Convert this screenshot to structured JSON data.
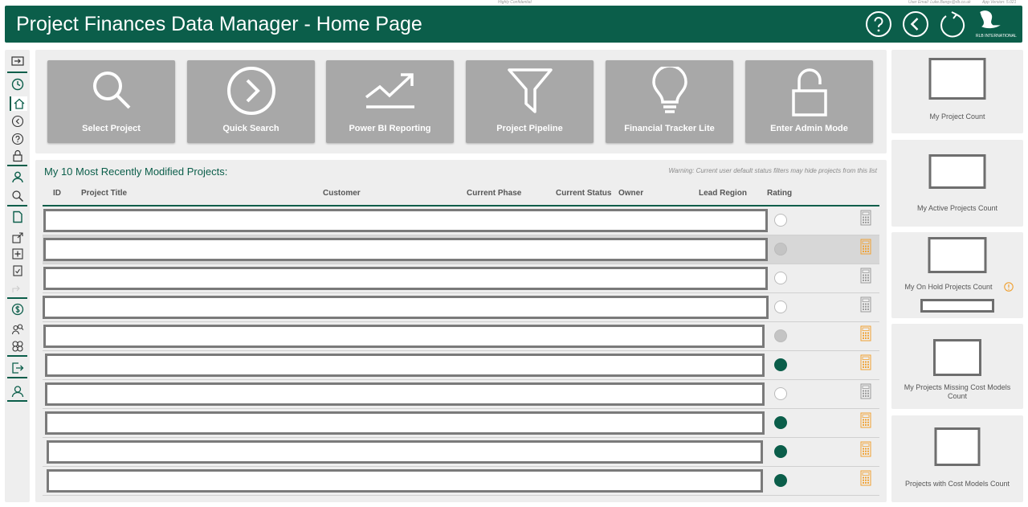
{
  "meta": {
    "confidential": "Highly Confidential",
    "user_email": "User Email: Luke.Bangs@rlb.co.uk",
    "app_version": "App Version: 5.021"
  },
  "header": {
    "title": "Project Finances Data Manager - Home Page",
    "logo_text": "RLB INTERNATIONAL",
    "help_icon": "question-circle-icon",
    "back_icon": "chevron-left-circle-icon",
    "refresh_icon": "refresh-icon"
  },
  "sidebar": {
    "items": [
      "collapse-toggle-icon",
      "clock-icon",
      "home-icon",
      "back-icon",
      "help-icon",
      "lock-icon",
      "user-icon",
      "search-icon",
      "document-icon",
      "open-external-icon",
      "add-icon",
      "checklist-icon",
      "share-icon",
      "dollar-icon",
      "users-search-icon",
      "people-group-icon",
      "exit-icon",
      "user-settings-icon"
    ]
  },
  "tiles": [
    {
      "label": "Select Project",
      "icon": "search-icon"
    },
    {
      "label": "Quick Search",
      "icon": "chevron-right-circle-icon"
    },
    {
      "label": "Power BI Reporting",
      "icon": "trend-chart-icon"
    },
    {
      "label": "Project Pipeline",
      "icon": "filter-funnel-icon"
    },
    {
      "label": "Financial Tracker Lite",
      "icon": "lightbulb-icon"
    },
    {
      "label": "Enter Admin Mode",
      "icon": "unlock-icon"
    }
  ],
  "recent": {
    "title": "My 10 Most Recently Modified Projects:",
    "warning": "Warning: Current user default status filters may hide projects from this list",
    "columns": [
      "ID",
      "Project Title",
      "Customer",
      "Current Phase",
      "Current Status",
      "Owner",
      "Lead Region",
      "Rating"
    ],
    "rows": [
      {
        "rating": "empty",
        "calc": "grey"
      },
      {
        "rating": "grey",
        "calc": "orange"
      },
      {
        "rating": "empty",
        "calc": "grey"
      },
      {
        "rating": "empty",
        "calc": "grey"
      },
      {
        "rating": "grey",
        "calc": "orange"
      },
      {
        "rating": "green",
        "calc": "orange"
      },
      {
        "rating": "empty",
        "calc": "grey"
      },
      {
        "rating": "green",
        "calc": "orange"
      },
      {
        "rating": "green",
        "calc": "orange"
      },
      {
        "rating": "green",
        "calc": "orange"
      }
    ]
  },
  "stats": [
    {
      "label": "My Project Count"
    },
    {
      "label": "My Active Projects Count"
    },
    {
      "label": "My On Hold Projects Count"
    },
    {
      "label": "My Projects Missing Cost Models Count"
    },
    {
      "label": "Projects with Cost Models Count"
    }
  ],
  "colors": {
    "brand": "#0b5e4a",
    "orange": "#f0a030",
    "tile": "#a8a8a8"
  }
}
